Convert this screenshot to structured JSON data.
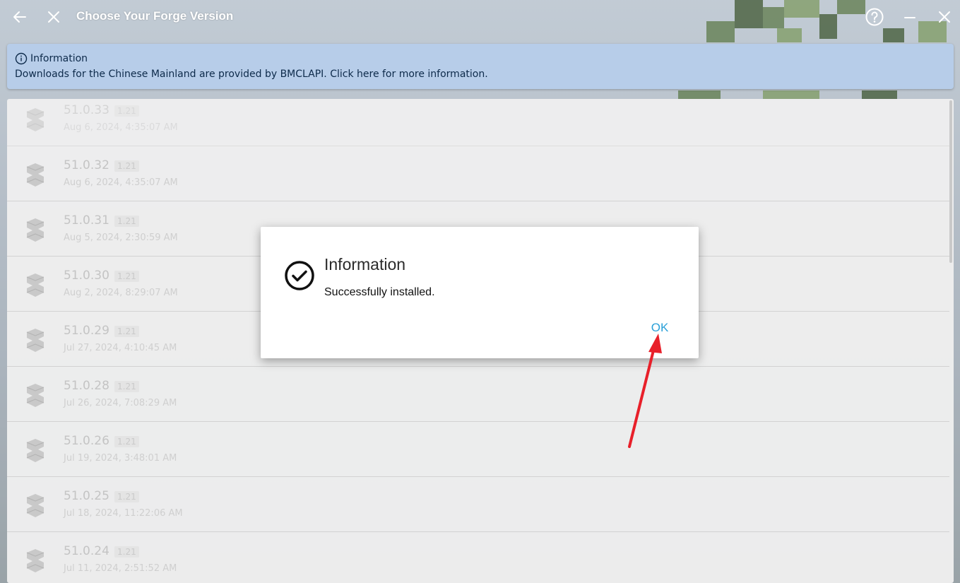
{
  "window": {
    "title": "Choose Your Forge Version",
    "back_icon": "arrow-left-icon",
    "close_page_icon": "close-icon",
    "help_icon": "help-icon",
    "minimize_icon": "minimize-icon",
    "window_close_icon": "close-icon"
  },
  "banner": {
    "icon": "info-circle-icon",
    "title": "Information",
    "text": "Downloads for the Chinese Mainland are provided by BMCLAPI. Click here for more information."
  },
  "versions": [
    {
      "version": "51.0.33",
      "mc": "1.21",
      "date": "Aug 6, 2024, 4:35:07 AM"
    },
    {
      "version": "51.0.32",
      "mc": "1.21",
      "date": "Aug 6, 2024, 4:35:07 AM"
    },
    {
      "version": "51.0.31",
      "mc": "1.21",
      "date": "Aug 5, 2024, 2:30:59 AM"
    },
    {
      "version": "51.0.30",
      "mc": "1.21",
      "date": "Aug 2, 2024, 8:29:07 AM"
    },
    {
      "version": "51.0.29",
      "mc": "1.21",
      "date": "Jul 27, 2024, 4:10:45 AM"
    },
    {
      "version": "51.0.28",
      "mc": "1.21",
      "date": "Jul 26, 2024, 7:08:29 AM"
    },
    {
      "version": "51.0.26",
      "mc": "1.21",
      "date": "Jul 19, 2024, 3:48:01 AM"
    },
    {
      "version": "51.0.25",
      "mc": "1.21",
      "date": "Jul 18, 2024, 11:22:06 AM"
    },
    {
      "version": "51.0.24",
      "mc": "1.21",
      "date": "Jul 11, 2024, 2:51:52 AM"
    }
  ],
  "dialog": {
    "icon": "check-circle-icon",
    "title": "Information",
    "message": "Successfully installed.",
    "ok_label": "OK"
  },
  "annotation": {
    "arrow_color": "#e8202a"
  },
  "colors": {
    "accent": "#2aa0d8",
    "banner_bg": "#b7cde9"
  }
}
